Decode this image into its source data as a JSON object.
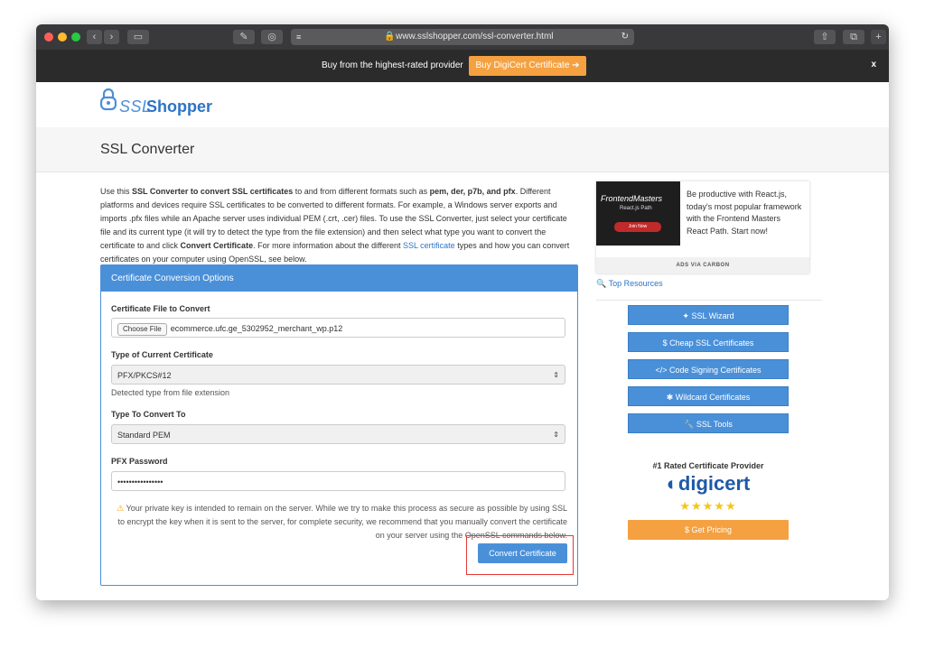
{
  "browser": {
    "url": "www.sslshopper.com/ssl-converter.html",
    "plus_label": "+",
    "colors": {
      "close": "#ff5f57",
      "minimize": "#febc2e",
      "zoom": "#28c840"
    }
  },
  "banner": {
    "text": "Buy from the highest-rated provider",
    "button_label": "Buy DigiCert Certificate ➔",
    "close_label": "x"
  },
  "logo": {
    "part1": "SSL",
    "part2": "Shopper"
  },
  "page_title": "SSL Converter",
  "intro": {
    "t1": "Use this ",
    "b1": "SSL Converter to convert SSL certificates",
    "t2": " to and from different formats such as ",
    "b2": "pem, der, p7b, and pfx",
    "t3": ". Different platforms and devices require SSL certificates to be converted to different formats. For example, a Windows server exports and imports .pfx files while an Apache server uses individual PEM (.crt, .cer) files. To use the SSL Converter, just select your certificate file and its current type (it will try to detect the type from the file extension) and then select what type you want to convert the certificate to and click ",
    "b3": "Convert Certificate",
    "t4": ". For more information about the different ",
    "link": "SSL certificate",
    "t5": " types and how you can convert certificates on your computer using OpenSSL, see below."
  },
  "panel": {
    "title": "Certificate Conversion Options",
    "file_label": "Certificate File to Convert",
    "choose_file": "Choose File",
    "file_name": "ecommerce.ufc.ge_5302952_merchant_wp.p12",
    "type_label": "Type of Current Certificate",
    "type_value": "PFX/PKCS#12",
    "type_help": "Detected type from file extension",
    "convert_to_label": "Type To Convert To",
    "convert_to_value": "Standard PEM",
    "password_label": "PFX Password",
    "password_value": "••••••••••••••••",
    "warning": "Your private key is intended to remain on the server. While we try to make this process as secure as possible by using SSL to encrypt the key when it is sent to the server, for complete security, we recommend that you manually convert the certificate on your server using the OpenSSL commands below.",
    "convert_button": "Convert Certificate"
  },
  "ad": {
    "brand": "FrontendMasters",
    "path": "React.js Path",
    "join": "Join Now",
    "text": "Be productive with React.js, today's most popular framework with the Frontend Masters React Path. Start now!",
    "footer": "ADS VIA CARBON"
  },
  "sidebar": {
    "top_resources": "Top Resources",
    "buttons": [
      {
        "label": "SSL Wizard"
      },
      {
        "label": "Cheap SSL Certificates"
      },
      {
        "label": "Code Signing Certificates"
      },
      {
        "label": "Wildcard Certificates"
      },
      {
        "label": "SSL Tools"
      }
    ],
    "rated": "#1 Rated Certificate Provider",
    "digicert": "digicert",
    "stars": "★★★★★",
    "pricing": "Get Pricing"
  }
}
